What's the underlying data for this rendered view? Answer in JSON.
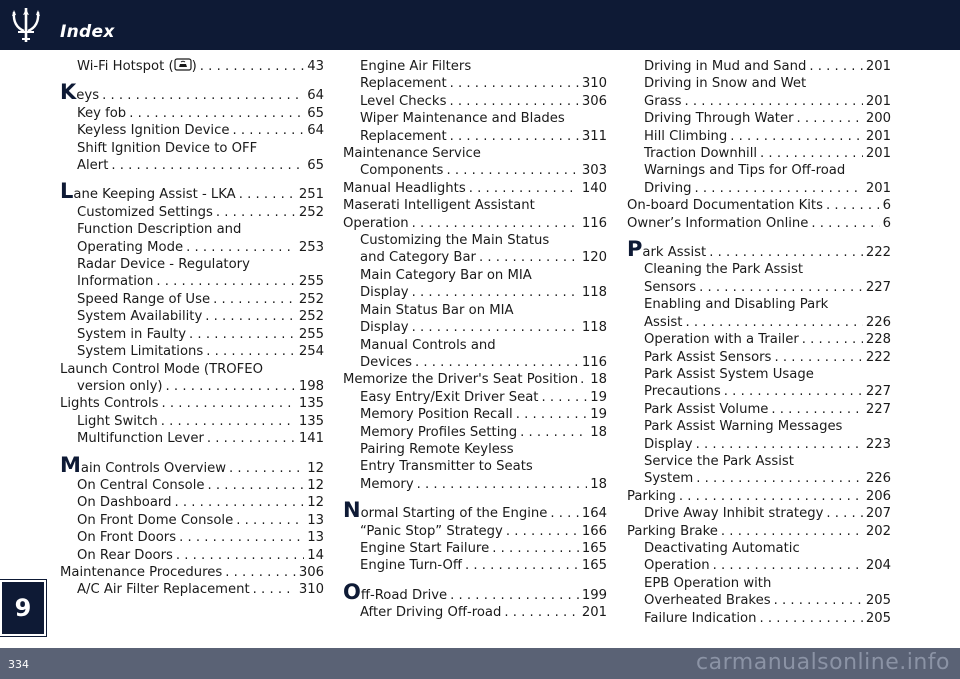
{
  "header": {
    "title": "Index",
    "logo_icon": "trident-icon"
  },
  "chapter_tab": "9",
  "footer": {
    "page_number": "334",
    "watermark": "carmanualsonline.info"
  },
  "colors": {
    "header_bg": "#0e1a35",
    "footer_bg": "#5a6275",
    "text": "#1a1a1a"
  },
  "col1": {
    "e1_label": "Wi-Fi Hotspot (",
    "e1_tail": ")",
    "e1_page": "43",
    "keys_big": "K",
    "keys_rest": "eys",
    "keys_page": "64",
    "keyfob": "Key fob",
    "keyfob_page": "65",
    "keyless": "Keyless Ignition Device",
    "keyless_page": "64",
    "shift1": "Shift Ignition Device to OFF",
    "shift2": "Alert",
    "shift_page": "65",
    "lane_big": "L",
    "lane_rest": "ane Keeping Assist - LKA",
    "lane_page": "251",
    "custom": "Customized Settings",
    "custom_page": "252",
    "func1": "Function Description and",
    "func2": "Operating Mode",
    "func_page": "253",
    "radar1": "Radar Device - Regulatory",
    "radar2": "Information",
    "radar_page": "255",
    "speed": "Speed Range of Use",
    "speed_page": "252",
    "sysavail": "System Availability",
    "sysavail_page": "252",
    "sysfault": "System in Faulty",
    "sysfault_page": "255",
    "syslim": "System Limitations",
    "syslim_page": "254",
    "launch1": "Launch Control Mode (TROFEO",
    "launch2": "version only)",
    "launch_page": "198",
    "lights": "Lights Controls",
    "lights_page": "135",
    "lightsw": "Light Switch",
    "lightsw_page": "135",
    "multi": "Multifunction Lever",
    "multi_page": "141",
    "main_big": "M",
    "main_rest": "ain Controls Overview",
    "main_page": "12",
    "central": "On Central Console",
    "central_page": "12",
    "dash": "On Dashboard",
    "dash_page": "12",
    "dome": "On Front Dome Console",
    "dome_page": "13",
    "fdoors": "On Front Doors",
    "fdoors_page": "13",
    "rdoors": "On Rear Doors",
    "rdoors_page": "14",
    "maint": "Maintenance Procedures",
    "maint_page": "306",
    "acfilter": "A/C Air Filter Replacement",
    "acfilter_page": "310"
  },
  "col2": {
    "eaf1": "Engine Air Filters",
    "eaf2": "Replacement",
    "eaf_page": "310",
    "level": "Level Checks",
    "level_page": "306",
    "wiper1": "Wiper Maintenance and Blades",
    "wiper2": "Replacement",
    "wiper_page": "311",
    "mserv1": "Maintenance Service",
    "mserv2": "Components",
    "mserv_page": "303",
    "manual": "Manual Headlights",
    "manual_page": "140",
    "mia1": "Maserati  Intelligent  Assistant",
    "mia2": "Operation",
    "mia_page": "116",
    "cust1": "Customizing the Main Status",
    "cust2": "and Category Bar",
    "cust_page": "120",
    "mcb1": "Main Category Bar on MIA",
    "mcb2": "Display",
    "mcb_page": "118",
    "msb1": "Main Status Bar on MIA",
    "msb2": "Display",
    "msb_page": "118",
    "mc1": "Manual Controls and",
    "mc2": "Devices",
    "mc_page": "116",
    "mem": "Memorize the Driver's Seat Position",
    "mem_page": "18",
    "easy": "Easy Entry/Exit Driver Seat",
    "easy_page": "19",
    "recall": "Memory Position Recall",
    "recall_page": "19",
    "profiles": "Memory Profiles Setting",
    "profiles_page": "18",
    "pair1": "Pairing Remote Keyless",
    "pair2": "Entry Transmitter to Seats",
    "pair3": "Memory",
    "pair_page": "18",
    "normal_big": "N",
    "normal_rest": "ormal Starting of the Engine",
    "normal_page": "164",
    "panic": "“Panic Stop” Strategy",
    "panic_page": "166",
    "esf": "Engine Start Failure",
    "esf_page": "165",
    "eto": "Engine Turn-Off",
    "eto_page": "165",
    "off_big": "O",
    "off_rest": "ff-Road Drive",
    "off_page": "199",
    "after": "After Driving Off-road",
    "after_page": "201"
  },
  "col3": {
    "mud": "Driving in Mud and Sand",
    "mud_page": "201",
    "snow1": "Driving in Snow and Wet",
    "snow2": "Grass",
    "snow_page": "201",
    "water": "Driving Through Water",
    "water_page": "200",
    "hill": "Hill Climbing",
    "hill_page": "201",
    "traction": "Traction Downhill",
    "traction_page": "201",
    "warn1": "Warnings and Tips for Off-road",
    "warn2": "Driving",
    "warn_page": "201",
    "onboard": "On-board Documentation Kits",
    "onboard_page": "6",
    "owner": "Owner’s Information Online",
    "owner_page": "6",
    "park_big": "P",
    "park_rest": "ark Assist",
    "park_page": "222",
    "clean1": "Cleaning the Park Assist",
    "clean2": "Sensors",
    "clean_page": "227",
    "enable1": "Enabling and Disabling Park",
    "enable2": "Assist",
    "enable_page": "226",
    "trailer": "Operation with a Trailer",
    "trailer_page": "228",
    "sensors": "Park Assist Sensors",
    "sensors_page": "222",
    "usage1": "Park Assist System Usage",
    "usage2": "Precautions",
    "usage_page": "227",
    "volume": "Park Assist Volume",
    "volume_page": "227",
    "pwarn1": "Park Assist Warning Messages",
    "pwarn2": "Display",
    "pwarn_page": "223",
    "service1": "Service the Park Assist",
    "service2": "System",
    "service_page": "226",
    "parking": "Parking",
    "parking_page": "206",
    "driveaway": "Drive Away Inhibit strategy",
    "driveaway_page": "207",
    "pbrake": "Parking Brake",
    "pbrake_page": "202",
    "deact1": "Deactivating Automatic",
    "deact2": "Operation",
    "deact_page": "204",
    "epb1": "EPB Operation with",
    "epb2": "Overheated Brakes",
    "epb_page": "205",
    "failure": "Failure Indication",
    "failure_page": "205"
  }
}
